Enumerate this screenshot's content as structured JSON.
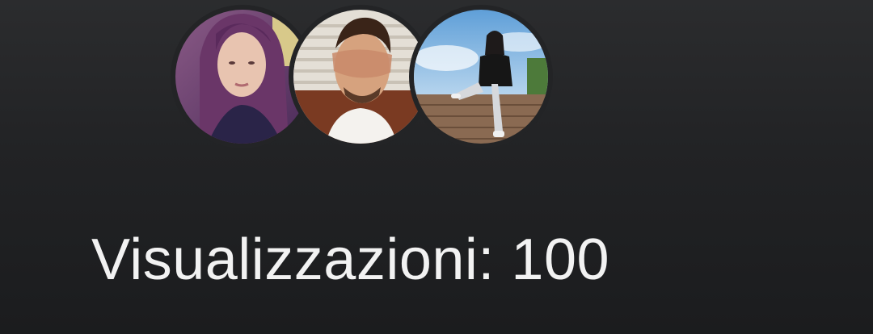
{
  "viewers": {
    "avatars": [
      {
        "alt": "viewer avatar 1"
      },
      {
        "alt": "viewer avatar 2"
      },
      {
        "alt": "viewer avatar 3"
      }
    ]
  },
  "stats": {
    "views_label": "Visualizzazioni: 100"
  }
}
